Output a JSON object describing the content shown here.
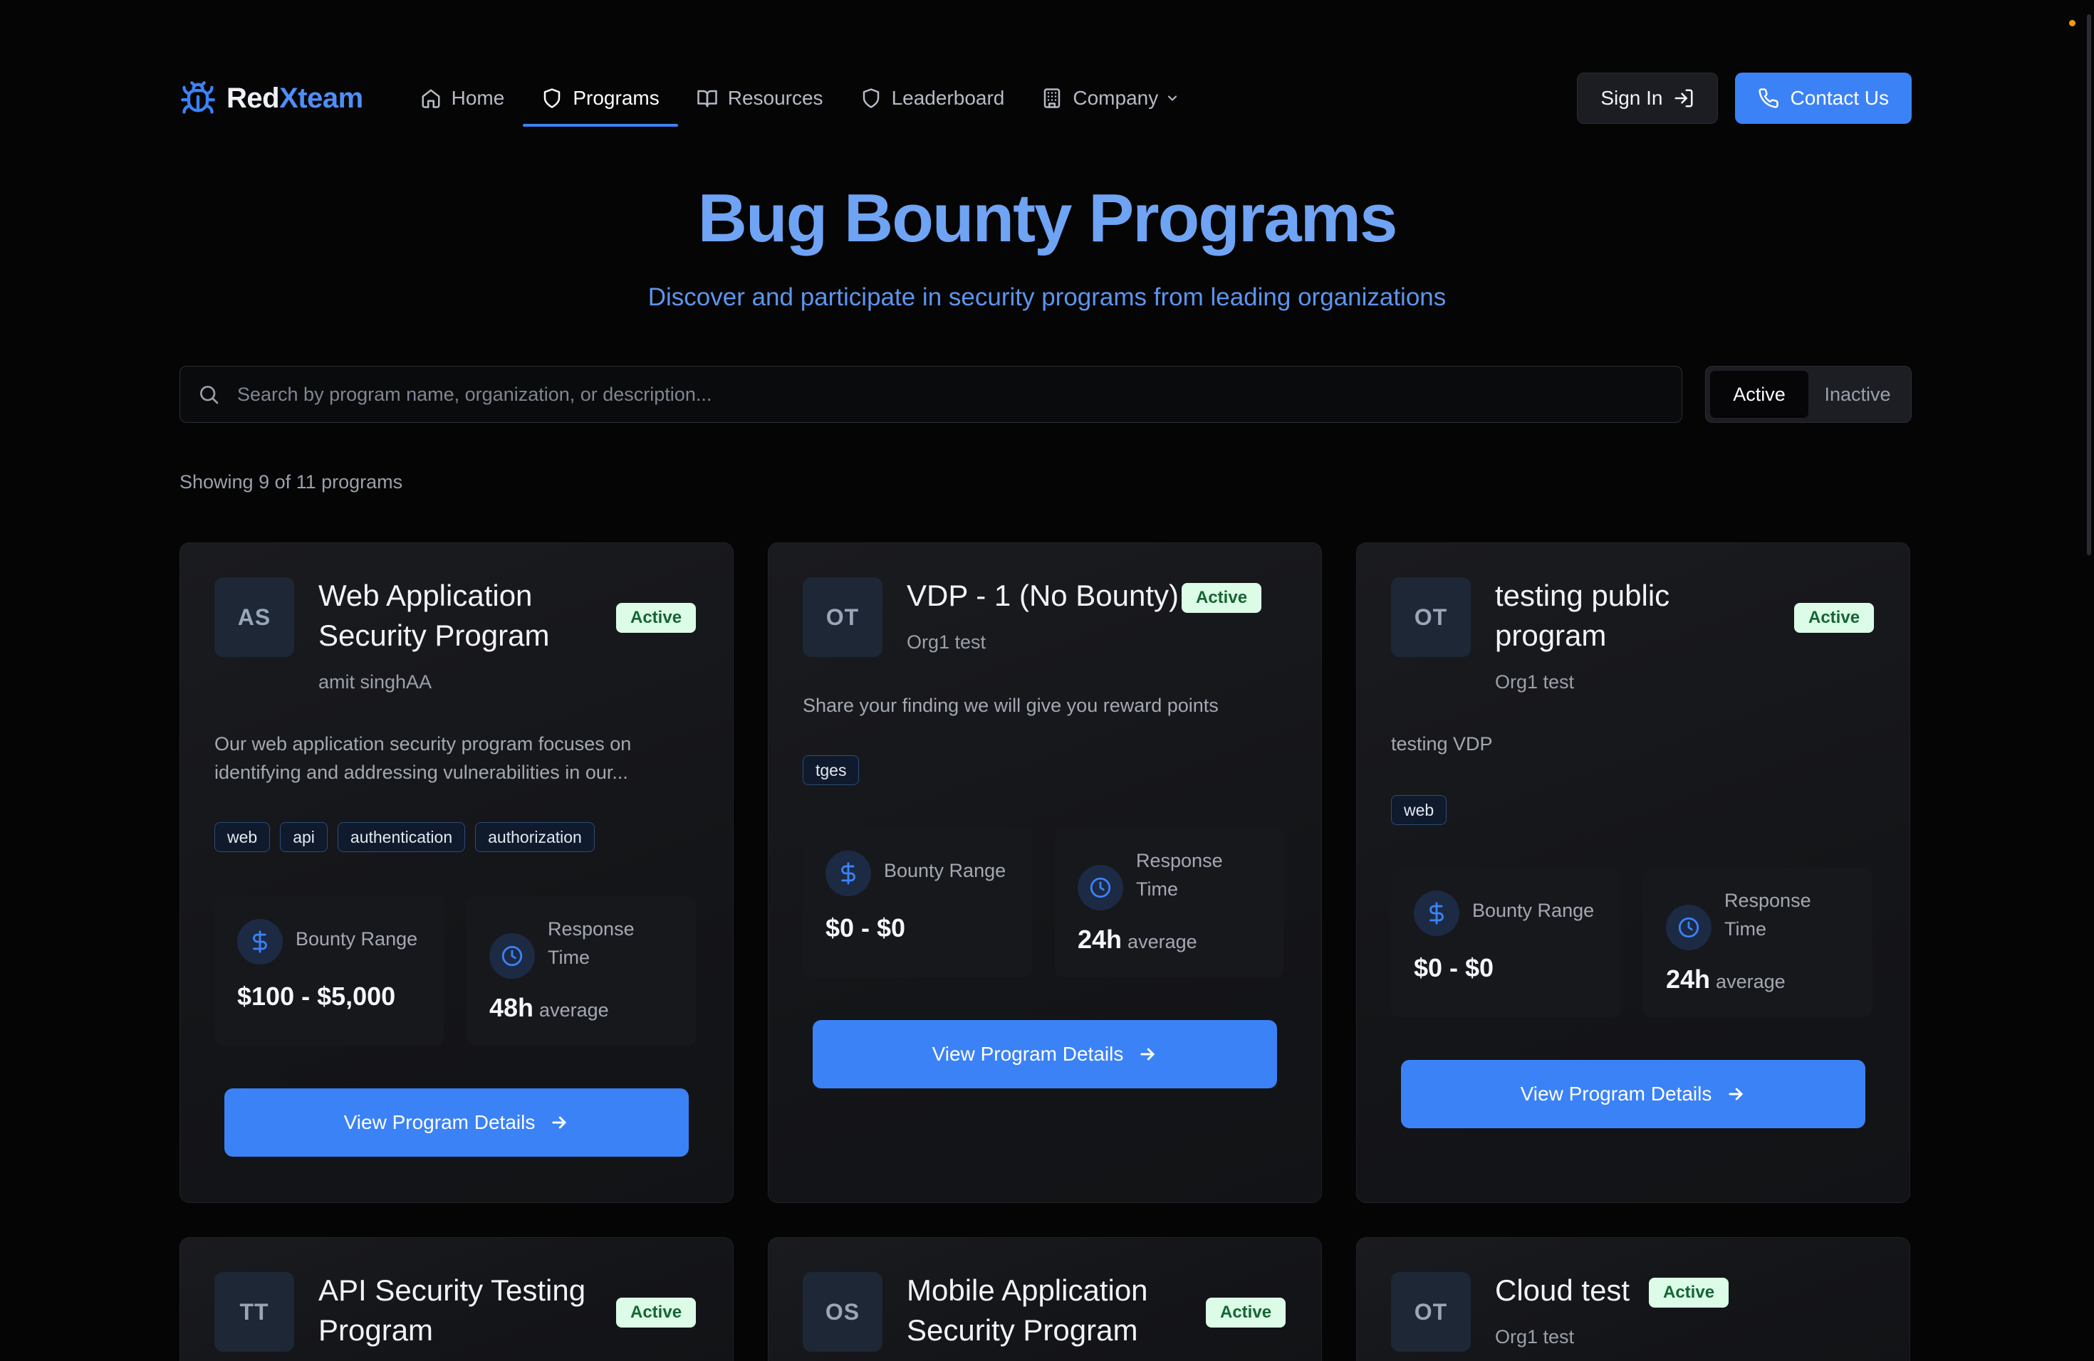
{
  "brand": {
    "name_part1": "Red",
    "name_part2": "Xteam",
    "logo_icon": "bug-icon",
    "accent_color": "#3b82f6"
  },
  "nav": {
    "items": [
      {
        "label": "Home",
        "icon": "home-icon"
      },
      {
        "label": "Programs",
        "icon": "shield-icon",
        "active": true
      },
      {
        "label": "Resources",
        "icon": "book-icon"
      },
      {
        "label": "Leaderboard",
        "icon": "shield-icon"
      },
      {
        "label": "Company",
        "icon": "building-icon",
        "has_dropdown": true
      }
    ],
    "sign_in_label": "Sign In",
    "contact_label": "Contact Us"
  },
  "hero": {
    "title": "Bug Bounty Programs",
    "subtitle": "Discover and participate in security programs from leading organizations"
  },
  "search": {
    "placeholder": "Search by program name, organization, or description...",
    "value": ""
  },
  "filter": {
    "active_label": "Active",
    "inactive_label": "Inactive",
    "selected": "Active"
  },
  "results": {
    "count_text": "Showing 9 of 11 programs"
  },
  "labels": {
    "bounty_range": "Bounty Range",
    "response_time": "Response Time",
    "response_time_l1": "Response",
    "response_time_l2": "Time",
    "average": "average",
    "view_details": "View Program Details"
  },
  "programs": [
    {
      "initials": "AS",
      "title_l1": "Web Application",
      "title_l2": "Security Program",
      "status": "Active",
      "org": "amit singhAA",
      "desc_l1": "Our web application security program focuses on",
      "desc_l2": "identifying and addressing vulnerabilities in our...",
      "tags": [
        "web",
        "api",
        "authentication",
        "authorization"
      ],
      "bounty": "$100 - $5,000",
      "response": "48h"
    },
    {
      "initials": "OT",
      "title_l1": "VDP - 1 (No Bounty)",
      "status": "Active",
      "org": "Org1 test",
      "desc_l1": "Share your finding we will give you reward points",
      "tags": [
        "tges"
      ],
      "bounty": "$0 - $0",
      "response": "24h"
    },
    {
      "initials": "OT",
      "title_l1": "testing public",
      "title_l2": "program",
      "status": "Active",
      "org": "Org1 test",
      "desc_l1": "testing VDP",
      "tags": [
        "web"
      ],
      "bounty": "$0 - $0",
      "response": "24h"
    },
    {
      "initials": "TT",
      "title_l1": "API Security Testing",
      "title_l2": "Program",
      "status": "Active"
    },
    {
      "initials": "OS",
      "title_l1": "Mobile Application",
      "title_l2": "Security Program",
      "status": "Active"
    },
    {
      "initials": "OT",
      "title_l1": "Cloud test",
      "status": "Active",
      "org": "Org1 test"
    }
  ]
}
